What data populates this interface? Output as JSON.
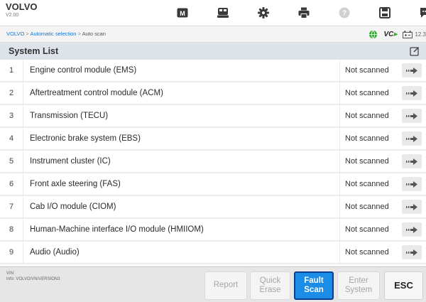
{
  "app": {
    "name": "VOLVO",
    "version": "V2.00"
  },
  "toolbar": {
    "icons": [
      "home-icon",
      "vehicle-swap-icon",
      "settings-icon",
      "print-icon",
      "help-icon",
      "save-icon",
      "message-icon"
    ]
  },
  "breadcrumb": {
    "part1": "VOLVO",
    "separator": " > ",
    "part2": "Automatic selection",
    "part3": "Auto scan"
  },
  "status": {
    "vci": "VC",
    "battery": "12.3"
  },
  "title": "System List",
  "systems": [
    {
      "num": "1",
      "name": "Engine control module (EMS)",
      "status": "Not scanned"
    },
    {
      "num": "2",
      "name": "Aftertreatment control module (ACM)",
      "status": "Not scanned"
    },
    {
      "num": "3",
      "name": "Transmission (TECU)",
      "status": "Not scanned"
    },
    {
      "num": "4",
      "name": "Electronic brake system (EBS)",
      "status": "Not scanned"
    },
    {
      "num": "5",
      "name": "Instrument cluster (IC)",
      "status": "Not scanned"
    },
    {
      "num": "6",
      "name": "Front axle steering (FAS)",
      "status": "Not scanned"
    },
    {
      "num": "7",
      "name": "Cab I/O module (CIOM)",
      "status": "Not scanned"
    },
    {
      "num": "8",
      "name": "Human-Machine interface I/O module (HMIIOM)",
      "status": "Not scanned"
    },
    {
      "num": "9",
      "name": "Audio (Audio)",
      "status": "Not scanned"
    }
  ],
  "vin_info": {
    "vin_label": "VIN:",
    "info": "Info: VOLVO/VN/VERSION3"
  },
  "buttons": {
    "report": "Report",
    "quick_erase_1": "Quick",
    "quick_erase_2": "Erase",
    "fault_scan_1": "Fault",
    "fault_scan_2": "Scan",
    "enter_system_1": "Enter",
    "enter_system_2": "System",
    "esc": "ESC"
  },
  "colors": {
    "accent": "#1b8de6",
    "link": "#1a73c8",
    "vci_green": "#3cab3c"
  }
}
